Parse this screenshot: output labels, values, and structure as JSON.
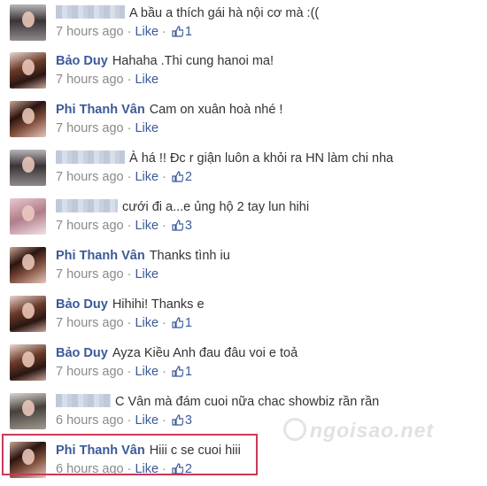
{
  "like_label": "Like",
  "comments": [
    {
      "author": "",
      "redacted_author": true,
      "redact_width": 78,
      "text": "A bầu a thích gái hà nội cơ mà :((",
      "time": "7 hours ago",
      "likes": "1",
      "avatar": "style-c"
    },
    {
      "author": "Bảo Duy",
      "redacted_author": false,
      "text": "Hahaha .Thi cung hanoi ma!",
      "time": "7 hours ago",
      "likes": "",
      "avatar": "style-a"
    },
    {
      "author": "Phi Thanh Vân",
      "redacted_author": false,
      "text": "Cam on xuân hoà nhé !",
      "time": "7 hours ago",
      "likes": "",
      "avatar": "style-b"
    },
    {
      "author": "",
      "redacted_author": true,
      "redact_width": 78,
      "text": "À há !! Đc r giận luôn a khỏi ra HN làm chi nha",
      "time": "7 hours ago",
      "likes": "2",
      "avatar": "style-c"
    },
    {
      "author": "",
      "redacted_author": true,
      "redact_width": 70,
      "text": "cưới đi a...e ủng hộ 2 tay lun hihi",
      "time": "7 hours ago",
      "likes": "3",
      "avatar": "style-d"
    },
    {
      "author": "Phi Thanh Vân",
      "redacted_author": false,
      "text": "Thanks tình iu",
      "time": "7 hours ago",
      "likes": "",
      "avatar": "style-b"
    },
    {
      "author": "Bảo Duy",
      "redacted_author": false,
      "text": "Hihihi! Thanks e",
      "time": "7 hours ago",
      "likes": "1",
      "avatar": "style-a"
    },
    {
      "author": "Bảo Duy",
      "redacted_author": false,
      "text": "Ayza Kiều Anh đau đâu voi e toả",
      "time": "7 hours ago",
      "likes": "1",
      "avatar": "style-a"
    },
    {
      "author": "",
      "redacted_author": true,
      "redact_width": 62,
      "text": "C Vân mà đám cuoi nữa chac showbiz rần rần",
      "time": "6 hours ago",
      "likes": "3",
      "avatar": "style-e"
    },
    {
      "author": "Phi Thanh Vân",
      "redacted_author": false,
      "text": "Hiii c se cuoi hiii",
      "time": "6 hours ago",
      "likes": "2",
      "avatar": "style-b"
    }
  ],
  "watermark": "ngoisao.net",
  "colors": {
    "link": "#3b5998",
    "meta": "#8a8a8a",
    "highlight": "#c83a57"
  }
}
